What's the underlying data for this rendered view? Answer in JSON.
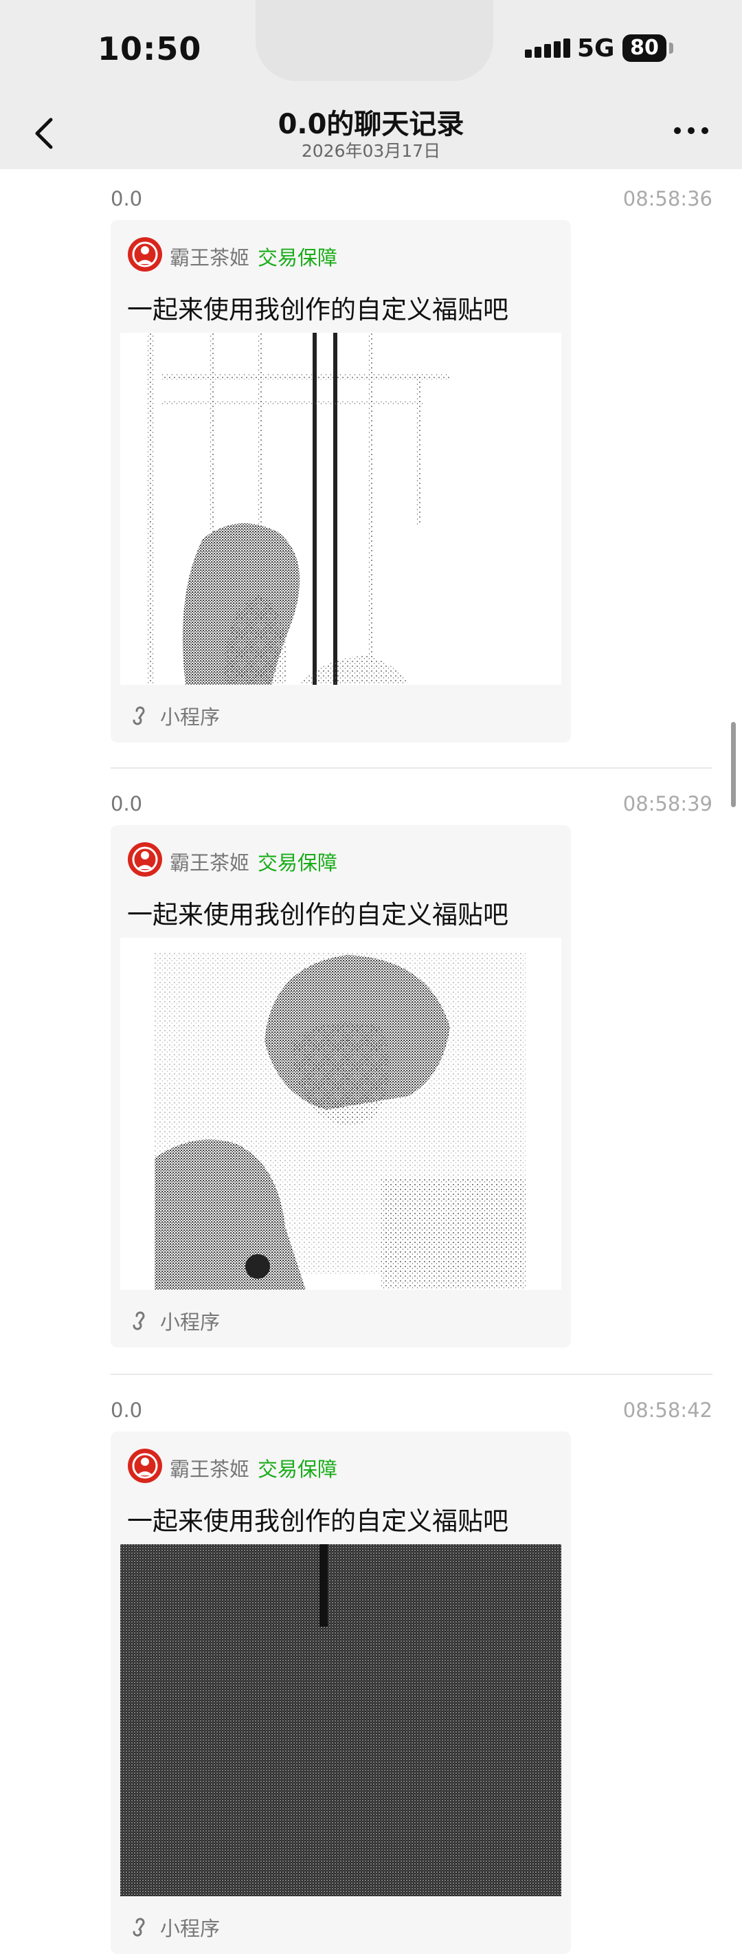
{
  "status_bar": {
    "time": "10:50",
    "network": "5G",
    "battery": "80"
  },
  "nav": {
    "title": "0.0的聊天记录",
    "subtitle": "2026年03月17日",
    "back_icon": "chevron-left-icon",
    "more_icon": "more-dots-icon"
  },
  "messages": [
    {
      "sender": "0.0",
      "time": "08:58:36",
      "card": {
        "app_name": "霸王茶姬",
        "badge": "交易保障",
        "title": "一起来使用我创作的自定义福贴吧",
        "image": "stippled portrait of a young man by a window",
        "footer": "小程序"
      }
    },
    {
      "sender": "0.0",
      "time": "08:58:39",
      "card": {
        "app_name": "霸王茶姬",
        "badge": "交易保障",
        "title": "一起来使用我创作的自定义福贴吧",
        "image": "stippled portrait of a young man in a jacket",
        "footer": "小程序"
      }
    },
    {
      "sender": "0.0",
      "time": "08:58:42",
      "card": {
        "app_name": "霸王茶姬",
        "badge": "交易保障",
        "title": "一起来使用我创作的自定义福贴吧",
        "image": "dark stippled image",
        "footer": "小程序"
      }
    }
  ],
  "colors": {
    "accent_green": "#1aad19",
    "logo_red": "#d9261c",
    "header_bg": "#ededed"
  }
}
